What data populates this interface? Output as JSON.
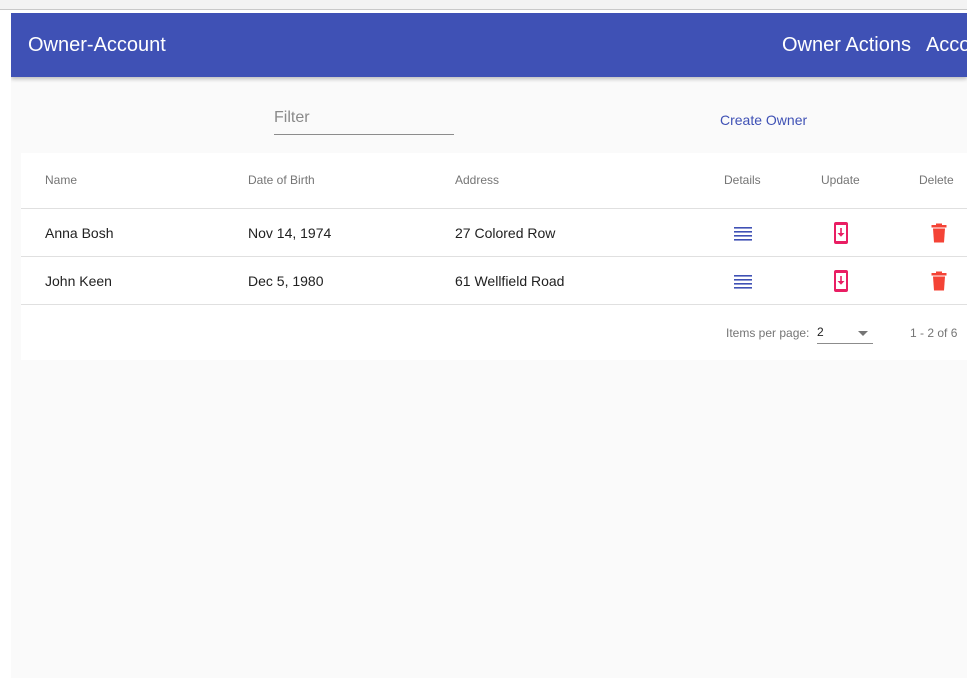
{
  "toolbar": {
    "brand": "Owner-Account",
    "nav_owner_actions": "Owner Actions",
    "nav_account_partial": "Acco"
  },
  "filter": {
    "placeholder": "Filter",
    "value": ""
  },
  "create_owner_label": "Create Owner",
  "table": {
    "columns": [
      "Name",
      "Date of Birth",
      "Address",
      "Details",
      "Update",
      "Delete"
    ],
    "rows": [
      {
        "name": "Anna Bosh",
        "dob": "Nov 14, 1974",
        "address": "27 Colored Row"
      },
      {
        "name": "John Keen",
        "dob": "Dec 5, 1980",
        "address": "61 Wellfield Road"
      }
    ],
    "icons": {
      "details": "list-icon",
      "update": "phone-update-icon",
      "delete": "trash-icon"
    }
  },
  "paginator": {
    "items_per_page_label": "Items per page:",
    "items_per_page_value": "2",
    "range_label": "1 - 2 of 6"
  },
  "colors": {
    "primary": "#3f51b5",
    "accent": "#e91e63",
    "warn": "#f44336",
    "background": "#fafafa"
  }
}
